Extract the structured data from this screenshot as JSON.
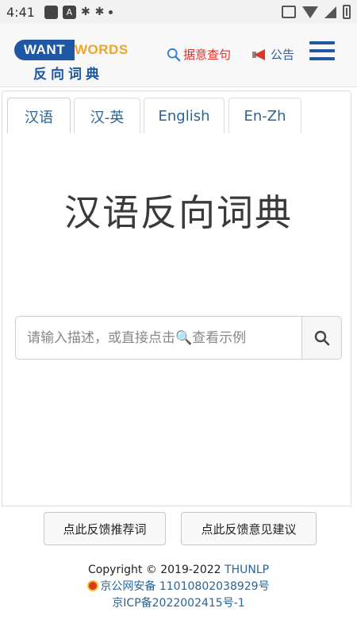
{
  "status_bar": {
    "time": "4:41"
  },
  "header": {
    "logo": {
      "want": "WANT",
      "words": "WORDS",
      "chinese": "反向词典"
    },
    "search_link": "据意查句",
    "notice_link": "公告",
    "brand_blue": "#1f57a3",
    "brand_orange": "#f0a526"
  },
  "tabs": [
    {
      "label": "汉语",
      "active": true
    },
    {
      "label": "汉-英",
      "active": false
    },
    {
      "label": "English",
      "active": false
    },
    {
      "label": "En-Zh",
      "active": false
    }
  ],
  "main": {
    "title": "汉语反向词典",
    "search_placeholder": "请输入描述，或直接点击🔍查看示例"
  },
  "buttons": {
    "recommend": "点此反馈推荐词",
    "feedback": "点此反馈意见建议"
  },
  "footer": {
    "copyright": "Copyright © 2019-2022 ",
    "org": "THUNLP",
    "police_record": "京公网安备 11010802038929号",
    "icp_record": "京ICP备2022002415号-1"
  }
}
